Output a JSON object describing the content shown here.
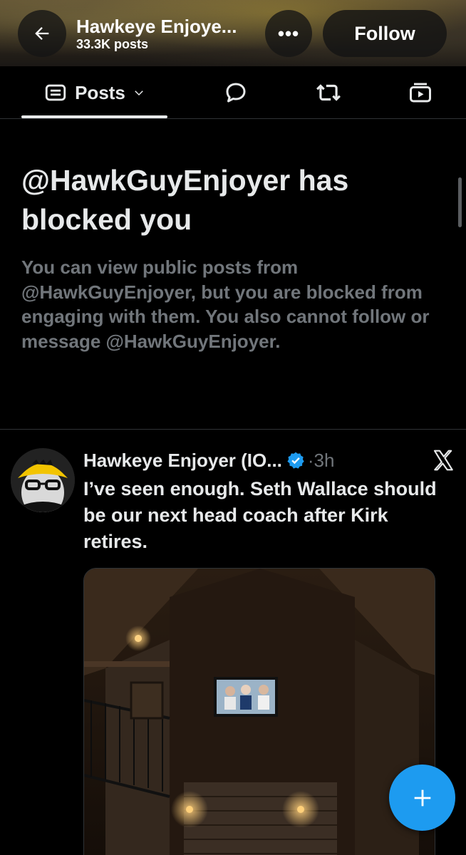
{
  "header": {
    "title": "Hawkeye Enjoye...",
    "post_count": "33.3K posts",
    "more_label": "•••",
    "follow_label": "Follow"
  },
  "tabs": {
    "active": {
      "label": "Posts",
      "icon": "posts-icon"
    },
    "others": [
      {
        "icon": "reply-icon"
      },
      {
        "icon": "repost-icon"
      },
      {
        "icon": "media-icon"
      }
    ]
  },
  "blocked": {
    "title": "@HawkGuyEnjoyer has blocked you",
    "body": "You can view public posts from @HawkGuyEnjoyer, but you are blocked from engaging with them. You also cannot follow or message @HawkGuyEnjoyer."
  },
  "post": {
    "author_name": "Hawkeye Enjoyer (IO...",
    "verified": true,
    "time": "·3h",
    "text": "I’ve seen enough. Seth Wallace should be our next head coach after Kirk retires.",
    "media_icon": "x-logo-icon"
  },
  "colors": {
    "background": "#000000",
    "text_primary": "#e7e9ea",
    "text_secondary": "#71767b",
    "accent": "#1d9bf0",
    "divider": "#2f3336"
  },
  "fab": {
    "icon": "plus-icon"
  }
}
